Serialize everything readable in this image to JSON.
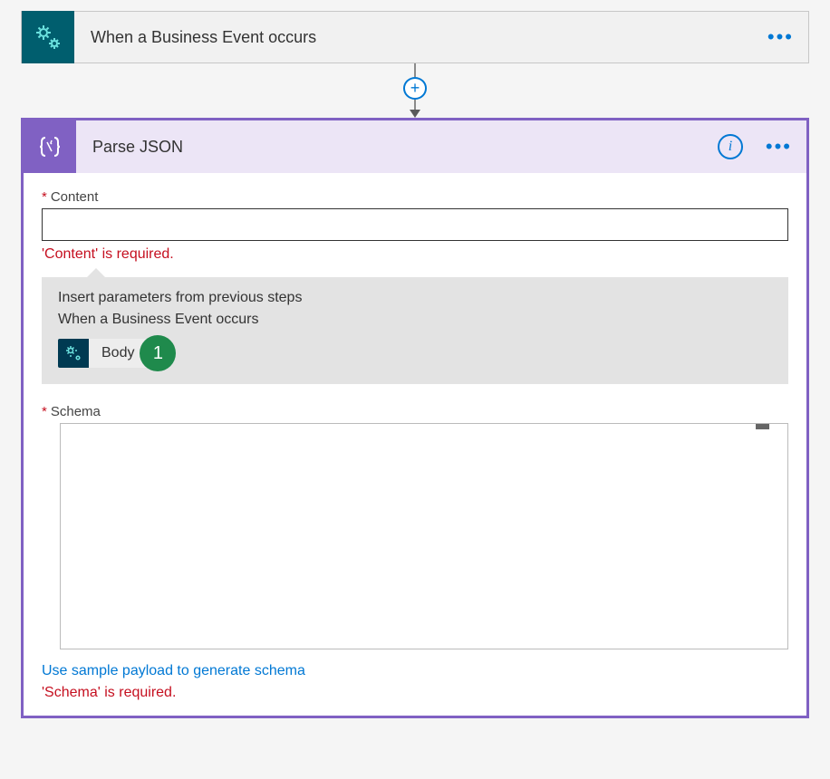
{
  "trigger": {
    "title": "When a Business Event occurs"
  },
  "action": {
    "title": "Parse JSON",
    "content_label": "Content",
    "content_value": "",
    "content_error": "'Content' is required.",
    "insert_title": "Insert parameters from previous steps",
    "insert_source": "When a Business Event occurs",
    "token_label": "Body",
    "callout_number": "1",
    "schema_label": "Schema",
    "schema_value": "",
    "schema_link": "Use sample payload to generate schema",
    "schema_error": "'Schema' is required."
  }
}
